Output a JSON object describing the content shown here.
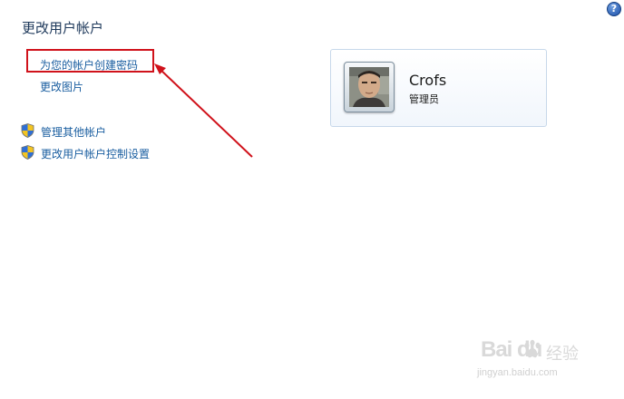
{
  "page": {
    "title": "更改用户帐户",
    "help_label": "?"
  },
  "tasks": {
    "create_password": "为您的帐户创建密码",
    "change_picture": "更改图片",
    "manage_other_accounts": "管理其他帐户",
    "change_uac_settings": "更改用户帐户控制设置"
  },
  "user": {
    "name": "Crofs",
    "role": "管理员"
  },
  "watermark": {
    "logo": "Bai du",
    "text": "经验",
    "url": "jingyan.baidu.com"
  },
  "icons": {
    "help": "help-icon",
    "shield": "uac-shield-icon",
    "paw": "baidu-paw-icon"
  },
  "colors": {
    "link": "#1a5ea0",
    "title": "#1e395b",
    "highlight": "#d0121b",
    "card_border": "#c7d8ea"
  }
}
